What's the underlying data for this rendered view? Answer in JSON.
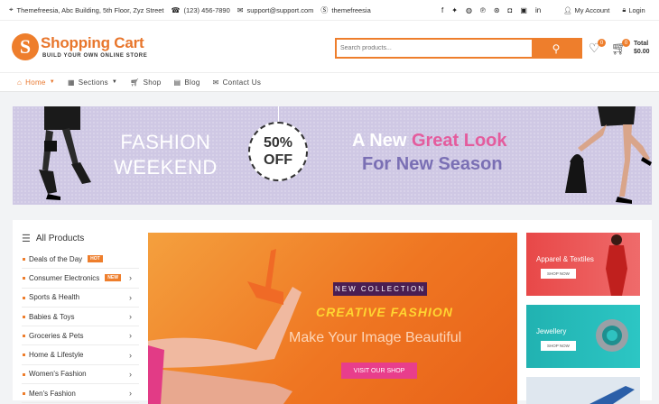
{
  "topbar": {
    "address": "Themefreesia, Abc Building, 5th Floor, Zyz Street",
    "phone": "(123) 456-7890",
    "email": "support@support.com",
    "skype": "themefreesia",
    "account_label": "My Account",
    "login_label": "Login",
    "social_icons": [
      "facebook-icon",
      "twitter-icon",
      "dribbble-icon",
      "pinterest-icon",
      "flickr-icon",
      "instagram-icon",
      "flickr-square-icon",
      "linkedin-icon"
    ]
  },
  "header": {
    "logo_letter": "S",
    "site_title": "Shopping Cart",
    "tagline": "BUILD YOUR OWN ONLINE STORE",
    "search_placeholder": "Search products...",
    "wishlist_count": "0",
    "cart_count": "0",
    "total_label": "Total",
    "total_value": "$0.00"
  },
  "nav": [
    {
      "label": "Home",
      "has_dropdown": true,
      "active": true
    },
    {
      "label": "Sections",
      "has_dropdown": true,
      "active": false
    },
    {
      "label": "Shop",
      "has_dropdown": false,
      "active": false
    },
    {
      "label": "Blog",
      "has_dropdown": false,
      "active": false
    },
    {
      "label": "Contact Us",
      "has_dropdown": false,
      "active": false
    }
  ],
  "banner": {
    "line1": "FASHION",
    "line2": "WEEKEND",
    "discount_pct": "50%",
    "discount_off": "OFF",
    "headline_a": "A New ",
    "headline_b": "Great Look",
    "headline_c": "For New Season"
  },
  "categories": {
    "title": "All Products",
    "items": [
      {
        "label": "Deals of the Day",
        "tag": "HOT",
        "arrow": false
      },
      {
        "label": "Consumer Electronics",
        "tag": "NEW",
        "arrow": true
      },
      {
        "label": "Sports & Health",
        "tag": "",
        "arrow": true
      },
      {
        "label": "Babies & Toys",
        "tag": "",
        "arrow": true
      },
      {
        "label": "Groceries & Pets",
        "tag": "",
        "arrow": true
      },
      {
        "label": "Home & Lifestyle",
        "tag": "",
        "arrow": true
      },
      {
        "label": "Women's Fashion",
        "tag": "",
        "arrow": true
      },
      {
        "label": "Men's Fashion",
        "tag": "",
        "arrow": true
      }
    ]
  },
  "hero": {
    "eyebrow": "NEW COLLECTION",
    "title": "CREATIVE FASHION",
    "subtitle": "Make Your Image Beautiful",
    "cta": "VISIT OUR SHOP"
  },
  "side_promos": [
    {
      "title": "Apparel & Textiles",
      "button": "SHOP NOW",
      "color": "#e84848"
    },
    {
      "title": "Jewellery",
      "button": "SHOP NOW",
      "color": "#21b2b1"
    }
  ],
  "colors": {
    "accent": "#ee7e2c",
    "pink": "#e45c9d",
    "purple": "#7a6fb4",
    "banner_bg": "#cfc8e4"
  }
}
